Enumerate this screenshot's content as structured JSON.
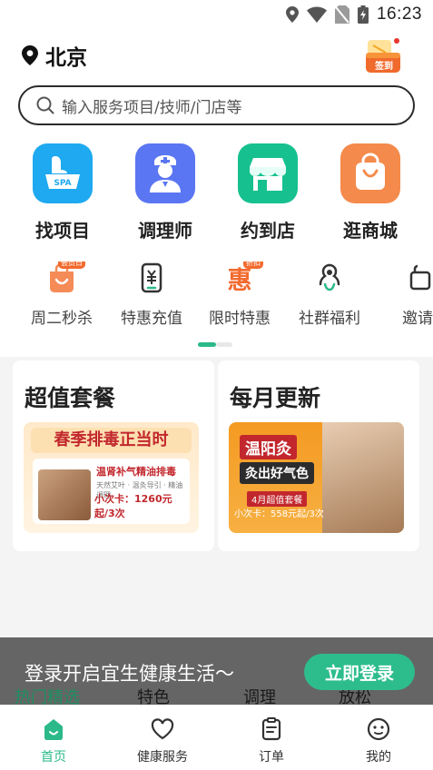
{
  "status_bar": {
    "time": "16:23"
  },
  "header": {
    "city": "北京",
    "signin_label": "签到"
  },
  "search": {
    "placeholder": "输入服务项目/技师/门店等"
  },
  "main_categories": [
    {
      "label": "找项目",
      "icon": "spa-basin-icon",
      "color": "#1ea9f0",
      "tile_text": "SPA"
    },
    {
      "label": "调理师",
      "icon": "nurse-icon",
      "color": "#5b76f2"
    },
    {
      "label": "约到店",
      "icon": "storefront-icon",
      "color": "#16c08f"
    },
    {
      "label": "逛商城",
      "icon": "shopping-bag-icon",
      "color": "#f48a4b"
    }
  ],
  "sub_entries": [
    {
      "label": "周二秒杀",
      "icon": "member-day-icon",
      "badge": "会员日"
    },
    {
      "label": "特惠充值",
      "icon": "phone-recharge-icon"
    },
    {
      "label": "限时特惠",
      "icon": "discount-icon",
      "badge": "折扣",
      "glyph": "惠"
    },
    {
      "label": "社群福利",
      "icon": "community-icon"
    },
    {
      "label": "邀请",
      "icon": "invite-icon"
    }
  ],
  "cards": [
    {
      "title": "超值套餐",
      "poster": {
        "headline": "春季排毒正当时",
        "subtitle": "温肾补气精油排毒",
        "desc": "天然艾叶 · 温灸导引 · 精油调理",
        "price": "小次卡：1260元起/3次"
      }
    },
    {
      "title": "每月更新",
      "poster": {
        "headline": "温阳灸",
        "subtitle": "灸出好气色",
        "badge": "4月超值套餐",
        "price": "小次卡：558元起/3次"
      }
    }
  ],
  "login_banner": {
    "text": "登录开启宜生健康生活～",
    "button": "立即登录",
    "tabs_behind": [
      "热门精选",
      "特色",
      "调理",
      "放松"
    ]
  },
  "bottom_nav": [
    {
      "label": "首页",
      "icon": "home-icon",
      "active": true
    },
    {
      "label": "健康服务",
      "icon": "heart-icon",
      "active": false
    },
    {
      "label": "订单",
      "icon": "clipboard-icon",
      "active": false
    },
    {
      "label": "我的",
      "icon": "smiley-user-icon",
      "active": false
    }
  ],
  "colors": {
    "accent": "#2bb98a",
    "brand_red": "#c2272d"
  }
}
